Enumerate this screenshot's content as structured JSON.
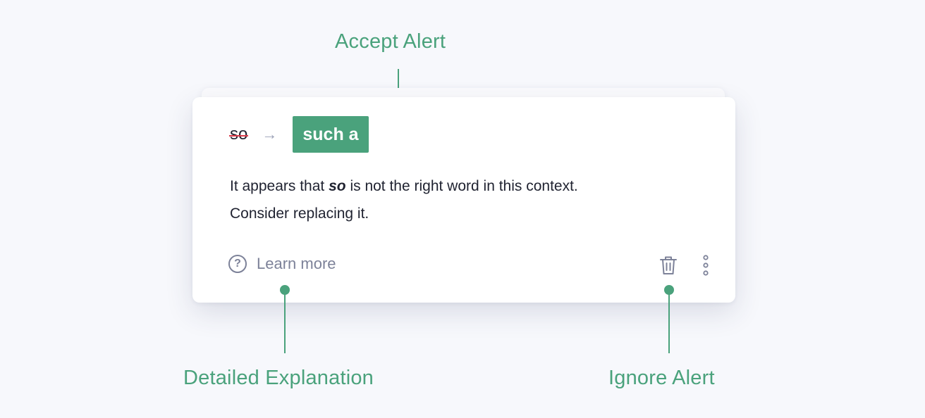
{
  "callouts": {
    "accept": "Accept Alert",
    "explanation": "Detailed Explanation",
    "ignore": "Ignore Alert"
  },
  "alert": {
    "original_word": "so",
    "arrow": "→",
    "replacement": "such a",
    "explanation_before": "It appears that ",
    "explanation_emphasis": "so",
    "explanation_after": " is not the right word in this context.",
    "explanation_line2": "Consider replacing it.",
    "learn_more_icon": "?",
    "learn_more": "Learn more"
  },
  "icons": {
    "help": "question-circle-icon",
    "ignore": "trash-icon",
    "more": "more-vertical-icon"
  },
  "colors": {
    "accent": "#4aa27c",
    "strikethrough": "#d93a4a",
    "muted": "#7d8299",
    "background": "#f7f8fc"
  }
}
